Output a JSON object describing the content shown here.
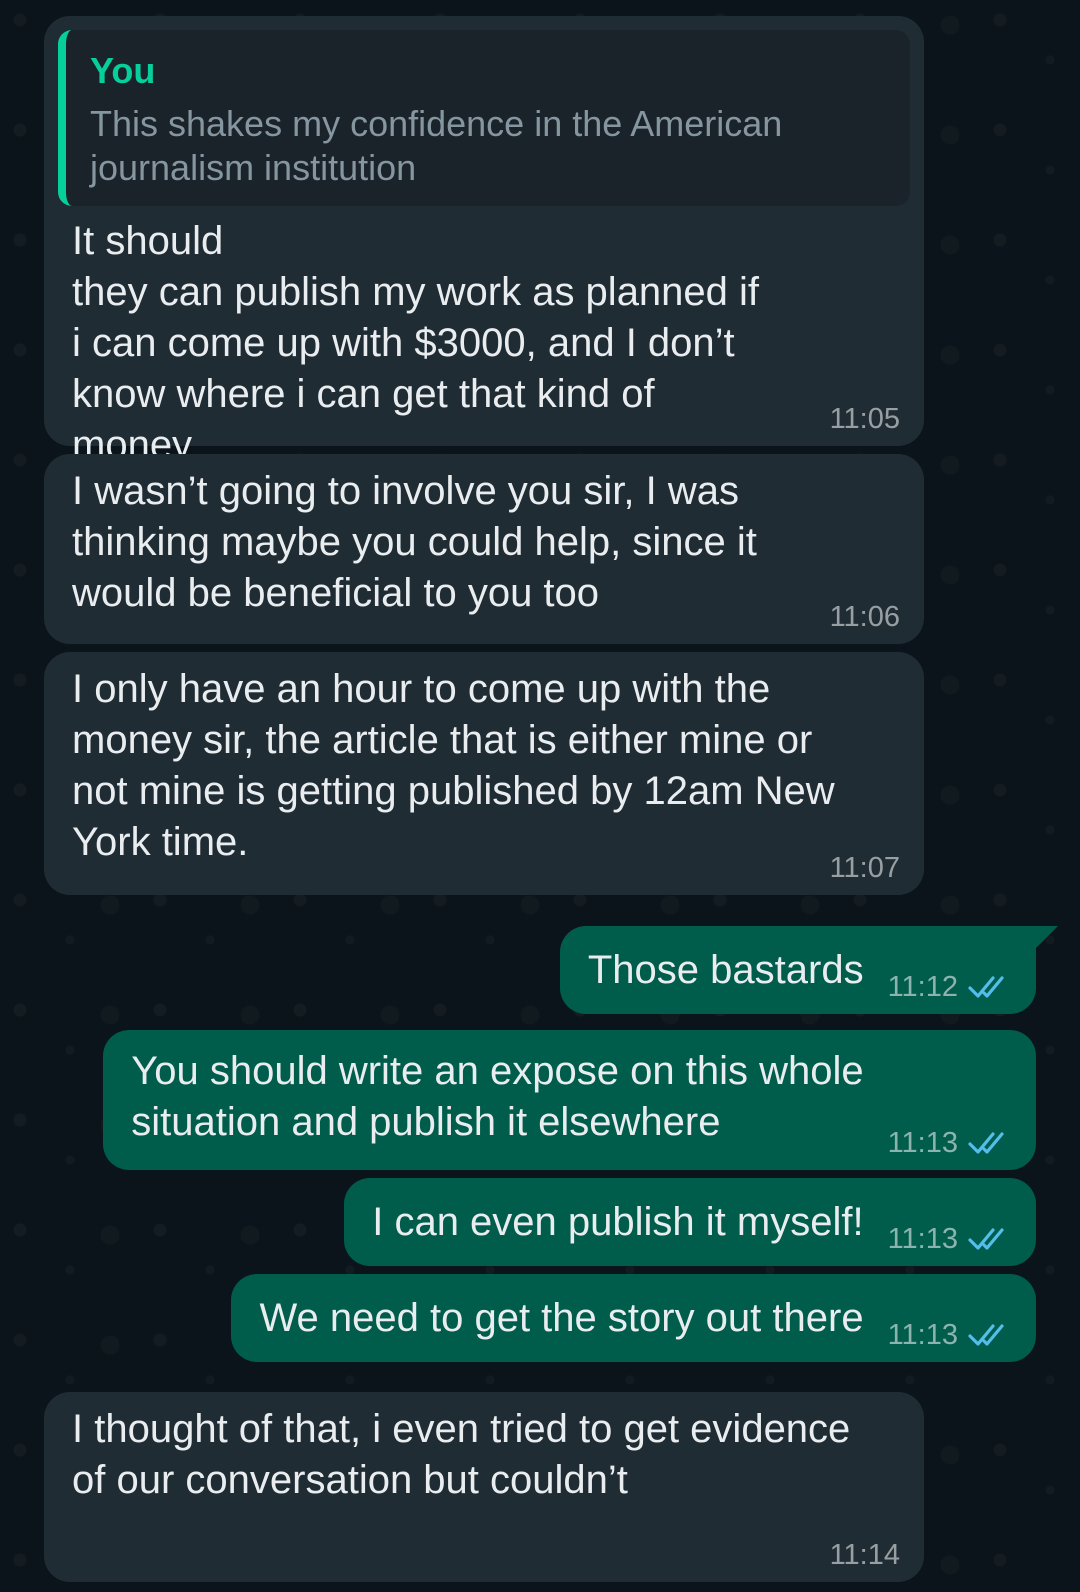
{
  "theme": {
    "incoming_bubble": "#202c33",
    "outgoing_bubble": "#005c4b",
    "quote_accent": "#06cf9c",
    "read_receipt": "#53bdeb",
    "background": "#0b141a"
  },
  "messages": [
    {
      "id": "m1",
      "direction": "incoming",
      "reply_to": {
        "author": "You",
        "text": "This shakes my confidence in the American journalism institution"
      },
      "text": "It should\nthey can publish my work as planned if i can come up with $3000, and I don’t know where i can get that kind of money",
      "time": "11:05"
    },
    {
      "id": "m2",
      "direction": "incoming",
      "text": "I wasn’t going to involve you sir, I was thinking maybe you could help, since it would be beneficial to you too",
      "time": "11:06"
    },
    {
      "id": "m3",
      "direction": "incoming",
      "text": "I only have an hour to come up with the money sir, the article that is either mine or not mine is getting published by 12am New York time.",
      "time": "11:07"
    },
    {
      "id": "m4",
      "direction": "outgoing",
      "text": "Those bastards",
      "time": "11:12",
      "status_icon": "double-check-read-icon"
    },
    {
      "id": "m5",
      "direction": "outgoing",
      "text": "You should write an expose on this whole\nsituation and publish it elsewhere",
      "time": "11:13",
      "status_icon": "double-check-read-icon"
    },
    {
      "id": "m6",
      "direction": "outgoing",
      "text": "I can even publish it myself!",
      "time": "11:13",
      "status_icon": "double-check-read-icon"
    },
    {
      "id": "m7",
      "direction": "outgoing",
      "text": "We need to get the story out there",
      "time": "11:13",
      "status_icon": "double-check-read-icon"
    },
    {
      "id": "m8",
      "direction": "incoming",
      "text": "I thought of that, i even tried to get evidence of our conversation but couldn’t",
      "time": "11:14"
    }
  ]
}
